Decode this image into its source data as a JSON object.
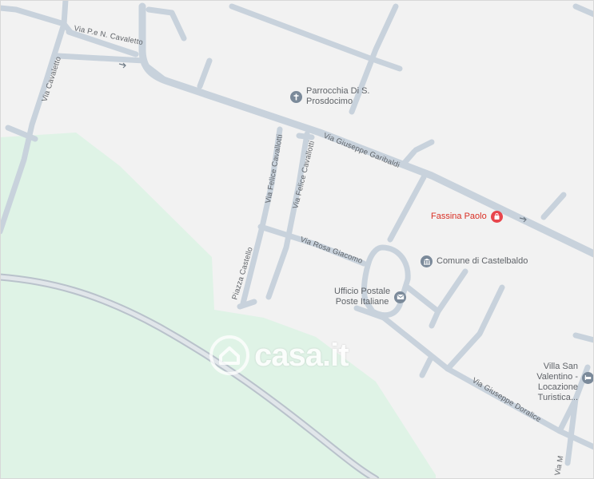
{
  "map": {
    "colors": {
      "background": "#f2f2f2",
      "park": "#dff3e6",
      "road": "#c9d3dd",
      "road_outline": "#b8c3cd",
      "highway": "#c3ccd5"
    },
    "streets": {
      "via_pe_n_cavaletto": "Via P.e N. Cavaletto",
      "via_cavaletto": "Via Cavaletto",
      "via_giuseppe_garibaldi": "Via Giuseppe Garibaldi",
      "via_felice_cavallotti_1": "Via Felice Cavallotti",
      "via_felice_cavallotti_2": "Via Felice Cavallotti",
      "piazza_castello": "Piazza Castello",
      "via_rosa_giacomo": "Via Rosa Giacomo",
      "via_giuseppe_doralice": "Via Giuseppe Doralice",
      "via_m": "Via M"
    },
    "pois": {
      "parrocchia": {
        "line1": "Parrocchia Di S.",
        "line2": "Prosdocimo",
        "icon": "church-icon"
      },
      "fassina": {
        "line1": "Fassina Paolo",
        "icon": "shopping-bag-icon",
        "color": "#d93025"
      },
      "comune": {
        "line1": "Comune di Castelbaldo",
        "icon": "town-hall-icon"
      },
      "ufficio_postale": {
        "line1": "Ufficio Postale",
        "line2": "Poste Italiane",
        "icon": "mail-icon"
      },
      "villa": {
        "line1": "Villa San Valentino -",
        "line2": "Locazione Turistica...",
        "icon": "lodging-icon"
      }
    },
    "watermark": {
      "text": "casa.it",
      "icon": "house-logo-icon"
    }
  }
}
